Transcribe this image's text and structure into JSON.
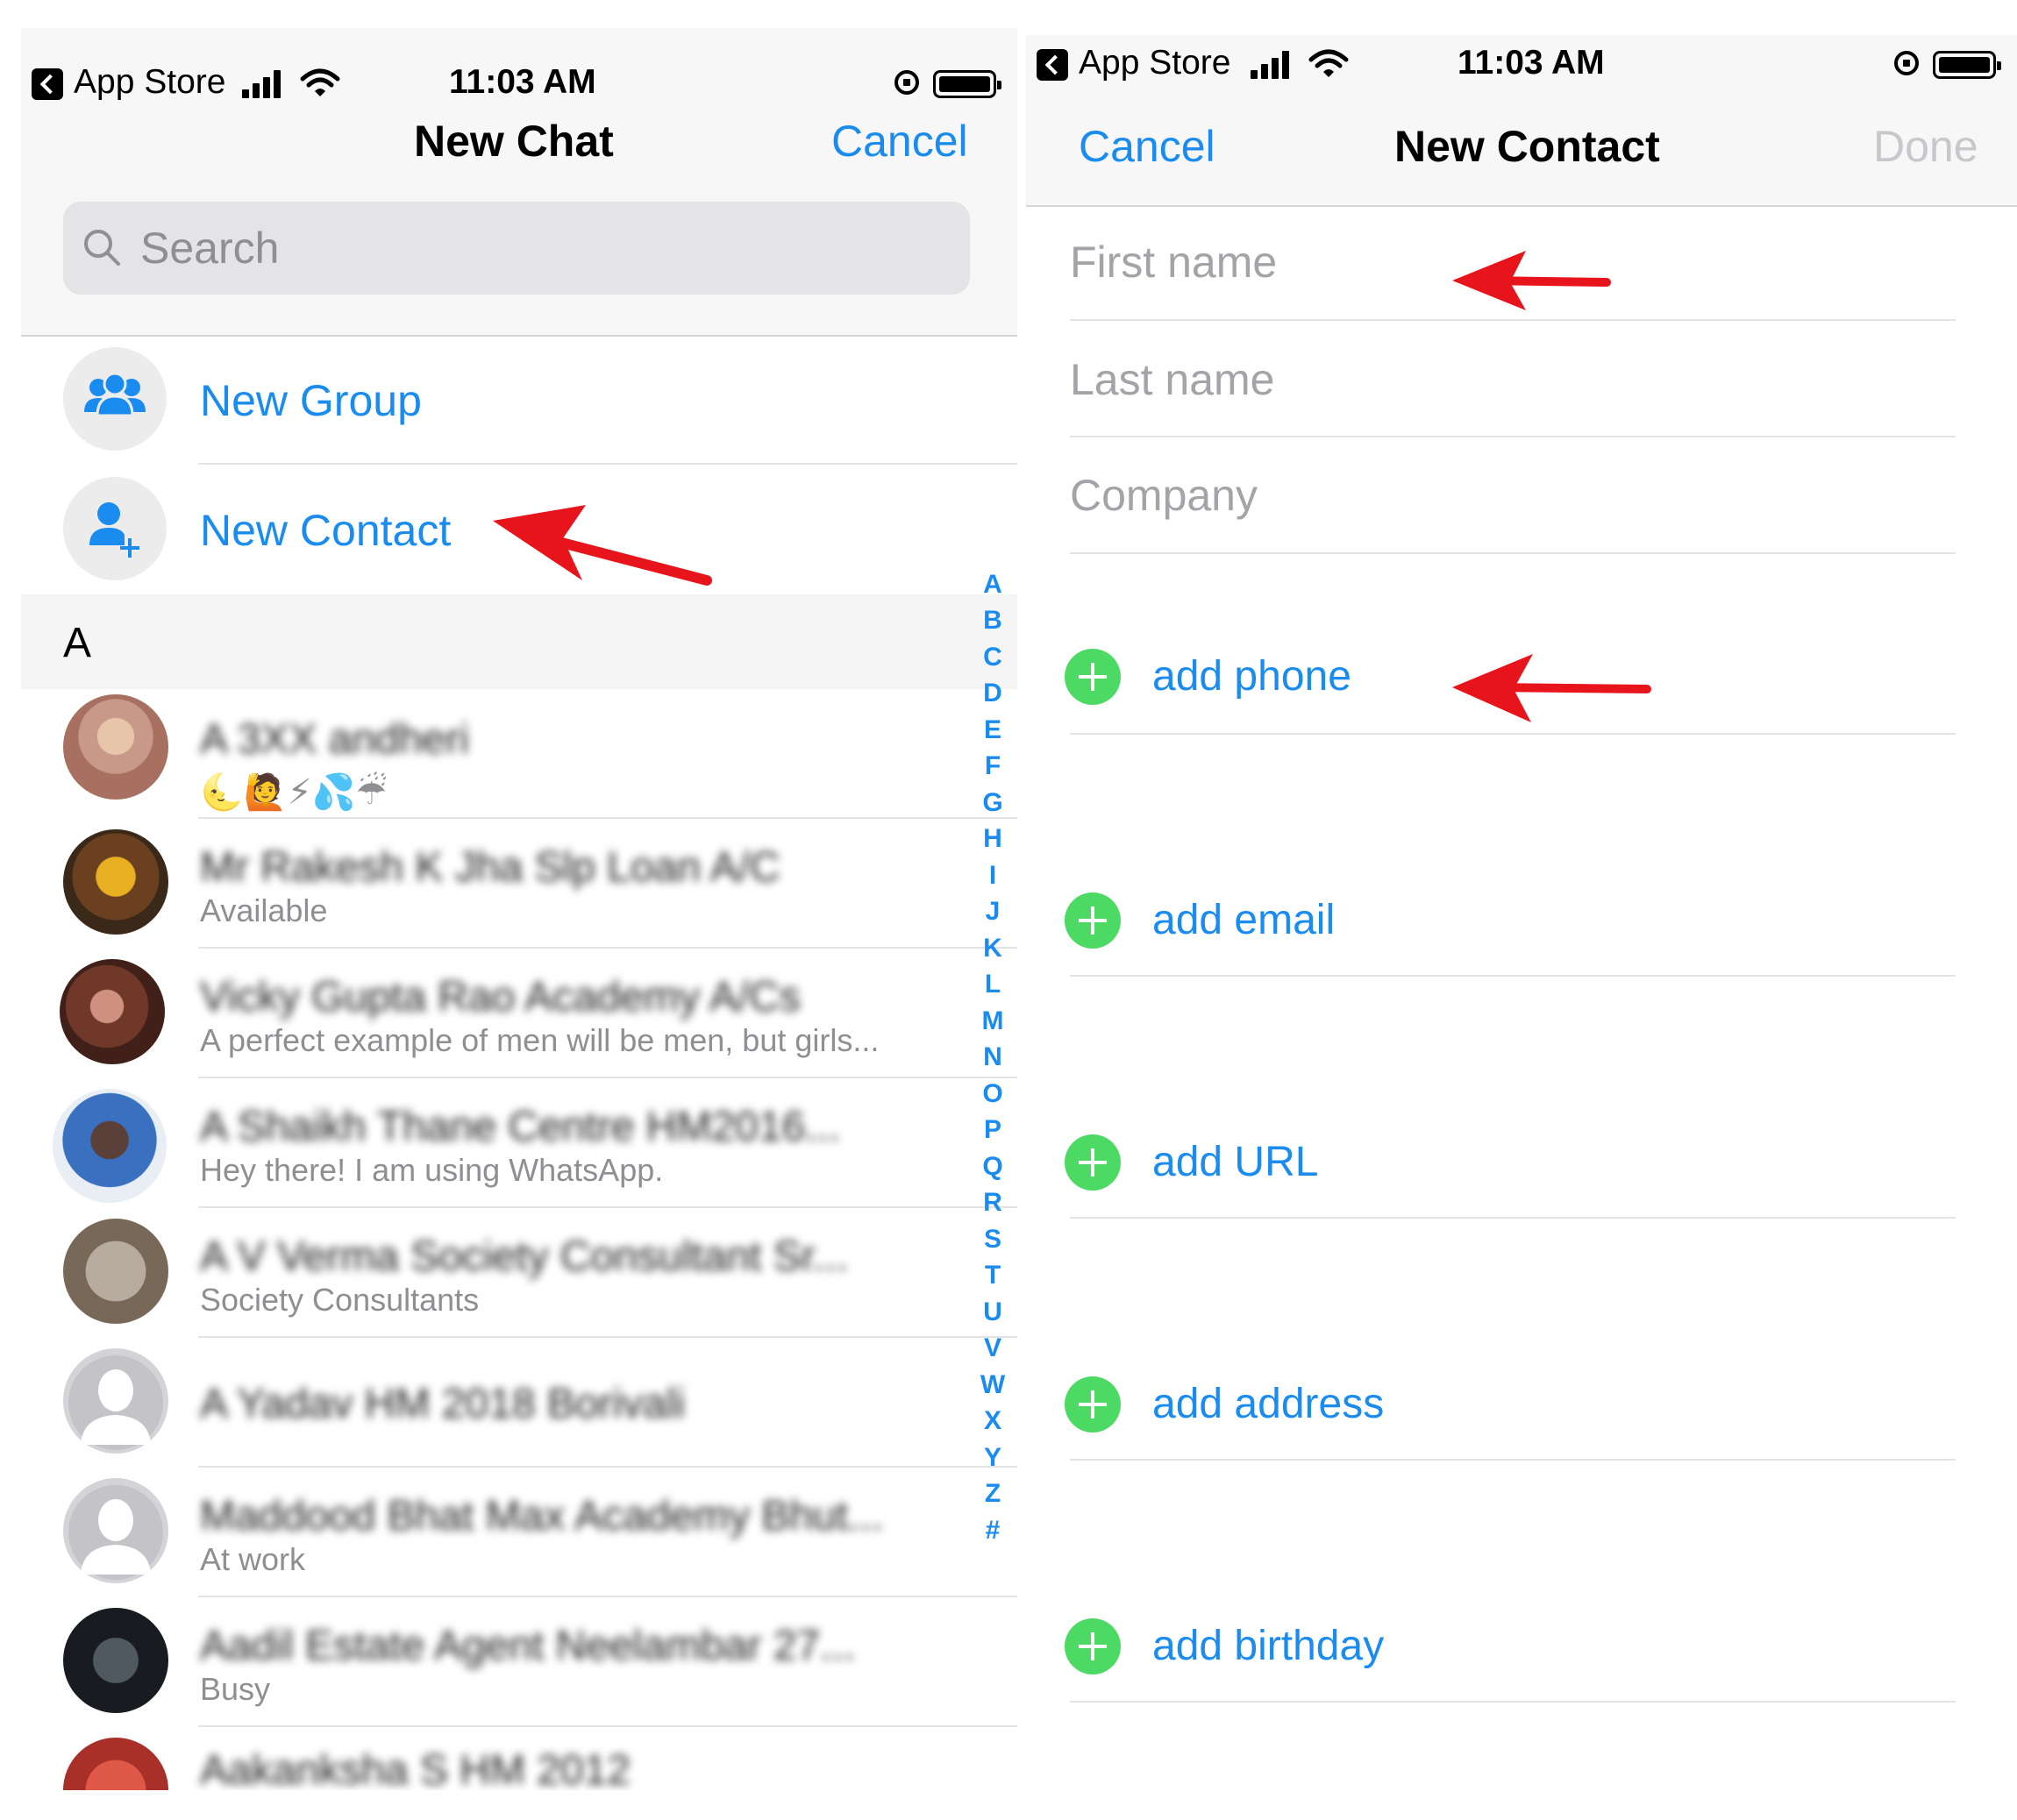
{
  "status_bar": {
    "back_app": "App Store",
    "time": "11:03 AM"
  },
  "new_chat": {
    "title": "New Chat",
    "cancel": "Cancel",
    "search_placeholder": "Search",
    "new_group": "New Group",
    "new_contact": "New Contact",
    "section_letter": "A",
    "contacts": [
      {
        "name": "A 3XX andheri",
        "status": "🌜🙋⚡💦☔"
      },
      {
        "name": "Mr Rakesh K Jha Slp Loan A/C",
        "status": "Available"
      },
      {
        "name": "Vicky Gupta Rao Academy A/Cs",
        "status": "A perfect example of men will be men, but girls..."
      },
      {
        "name": "A Shaikh Thane Centre HM2016...",
        "status": "Hey there! I am using WhatsApp."
      },
      {
        "name": "A V Verma Society Consultant Sr...",
        "status": "Society Consultants"
      },
      {
        "name": "A Yadav HM 2018 Borivali",
        "status": ""
      },
      {
        "name": "Maddood Bhat Max Academy Bhut...",
        "status": "At work"
      },
      {
        "name": "Aadil Estate Agent Neelambar 27...",
        "status": "Busy"
      },
      {
        "name": "Aakanksha S HM 2012",
        "status": ""
      }
    ],
    "index": [
      "A",
      "B",
      "C",
      "D",
      "E",
      "F",
      "G",
      "H",
      "I",
      "J",
      "K",
      "L",
      "M",
      "N",
      "O",
      "P",
      "Q",
      "R",
      "S",
      "T",
      "U",
      "V",
      "W",
      "X",
      "Y",
      "Z",
      "#"
    ]
  },
  "new_contact": {
    "title": "New Contact",
    "cancel": "Cancel",
    "done": "Done",
    "first_name_placeholder": "First name",
    "last_name_placeholder": "Last name",
    "company_placeholder": "Company",
    "add_phone": "add phone",
    "add_email": "add email",
    "add_url": "add URL",
    "add_address": "add address",
    "add_birthday": "add birthday"
  },
  "colors": {
    "accent": "#1a8cf0",
    "add_green": "#4cd964",
    "annotation_red": "#e8141b",
    "done_disabled": "#c7c7cc"
  }
}
